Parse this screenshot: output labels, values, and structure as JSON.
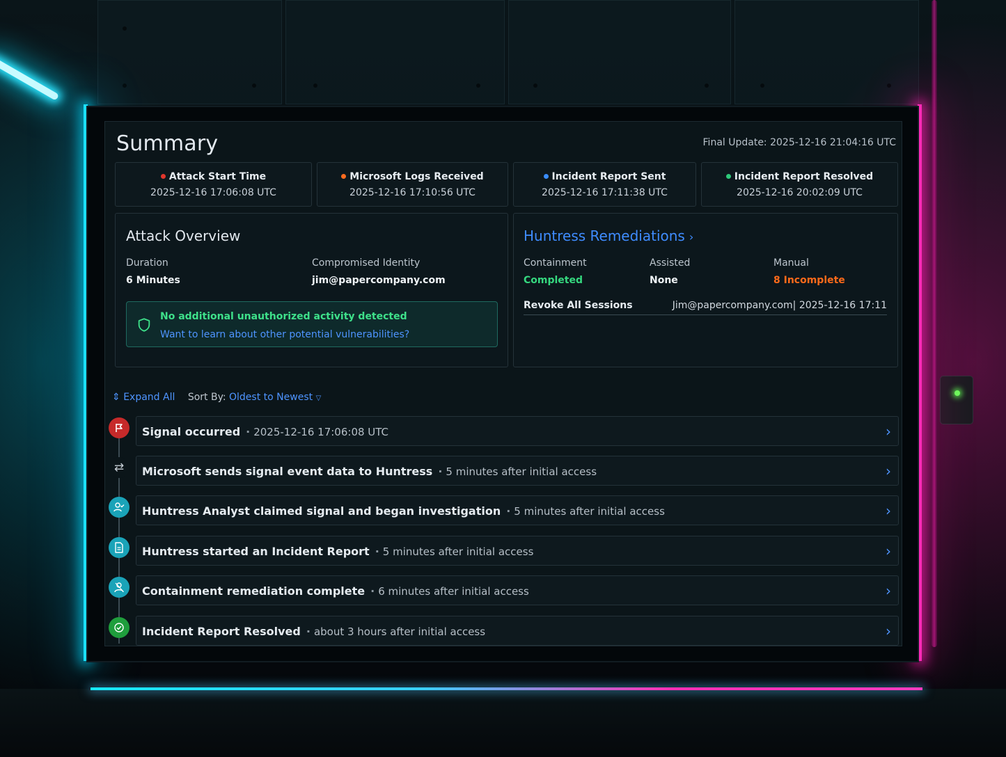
{
  "header": {
    "title": "Summary",
    "final_update": "Final Update: 2025-12-16 21:04:16 UTC"
  },
  "stats": [
    {
      "label": "Attack Start Time",
      "value": "2025-12-16 17:06:08 UTC",
      "dot_color": "#e0362c"
    },
    {
      "label": "Microsoft Logs Received",
      "value": "2025-12-16 17:10:56 UTC",
      "dot_color": "#ff6b1f"
    },
    {
      "label": "Incident Report Sent",
      "value": "2025-12-16 17:11:38 UTC",
      "dot_color": "#3a8dff"
    },
    {
      "label": "Incident Report Resolved",
      "value": "2025-12-16 20:02:09 UTC",
      "dot_color": "#2ec97a"
    }
  ],
  "attack_overview": {
    "title": "Attack Overview",
    "duration_label": "Duration",
    "duration_value": "6 Minutes",
    "identity_label": "Compromised Identity",
    "identity_value": "jim@papercompany.com",
    "notice_title": "No additional unauthorized activity detected",
    "notice_link": "Want to learn about other potential vulnerabilities?",
    "notice_icon": "shield-icon"
  },
  "remediations": {
    "title": "Huntress Remediations",
    "containment_label": "Containment",
    "containment_value": "Completed",
    "assisted_label": "Assisted",
    "assisted_value": "None",
    "manual_label": "Manual",
    "manual_value": "8 Incomplete",
    "revoke_label": "Revoke All Sessions",
    "revoke_value": "Jim@papercompany.com| 2025-12-16 17:11",
    "colors": {
      "completed": "#35d87f",
      "incomplete": "#ff6a1a",
      "link": "#3f8cff"
    }
  },
  "toolbar": {
    "expand_all": "Expand All",
    "sort_label": "Sort By:",
    "sort_value": "Oldest to Newest"
  },
  "timeline": [
    {
      "title": "Signal occurred",
      "detail": "2025-12-16 17:06:08 UTC",
      "icon": "flag-icon",
      "icon_color": "#c62a2a"
    },
    {
      "title": "Microsoft sends signal event data to Huntress",
      "detail": "5 minutes after initial access",
      "icon": "transfer-icon",
      "icon_color": "transparent"
    },
    {
      "title": "Huntress Analyst claimed signal and began investigation",
      "detail": "5 minutes after initial access",
      "icon": "user-check-icon",
      "icon_color": "#1aa3b8"
    },
    {
      "title": "Huntress started an Incident Report",
      "detail": "5 minutes after initial access",
      "icon": "document-icon",
      "icon_color": "#1aa3b8"
    },
    {
      "title": "Containment remediation complete",
      "detail": "6 minutes after initial access",
      "icon": "user-shield-icon",
      "icon_color": "#1aa3b8"
    },
    {
      "title": "Incident Report Resolved",
      "detail": "about 3 hours after initial access",
      "icon": "check-circle-icon",
      "icon_color": "#1f9e3c"
    }
  ]
}
